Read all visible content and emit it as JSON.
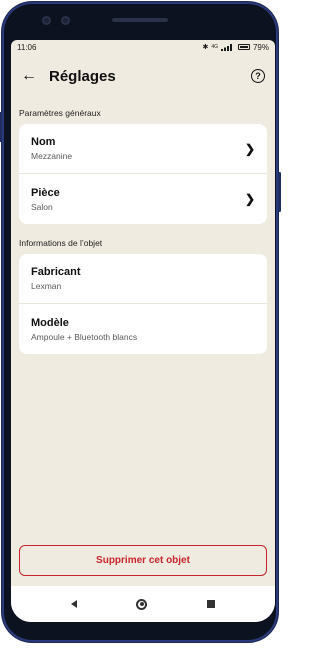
{
  "status": {
    "time": "11:06",
    "battery": "79%",
    "network": "4G"
  },
  "header": {
    "title": "Réglages",
    "back_icon": "arrow-left-icon",
    "help_icon": "question-circle-icon",
    "help_glyph": "?"
  },
  "sections": {
    "general": {
      "title": "Paramètres généraux",
      "rows": [
        {
          "label": "Nom",
          "value": "Mezzanine"
        },
        {
          "label": "Pièce",
          "value": "Salon"
        }
      ]
    },
    "object": {
      "title": "Informations de l’objet",
      "rows": [
        {
          "label": "Fabricant",
          "value": "Lexman"
        },
        {
          "label": "Modèle",
          "value": "Ampoule + Bluetooth blancs"
        }
      ]
    }
  },
  "actions": {
    "delete_label": "Supprimer cet objet"
  },
  "colors": {
    "background": "#f0ebe0",
    "danger": "#c7242b",
    "card": "#ffffff"
  }
}
